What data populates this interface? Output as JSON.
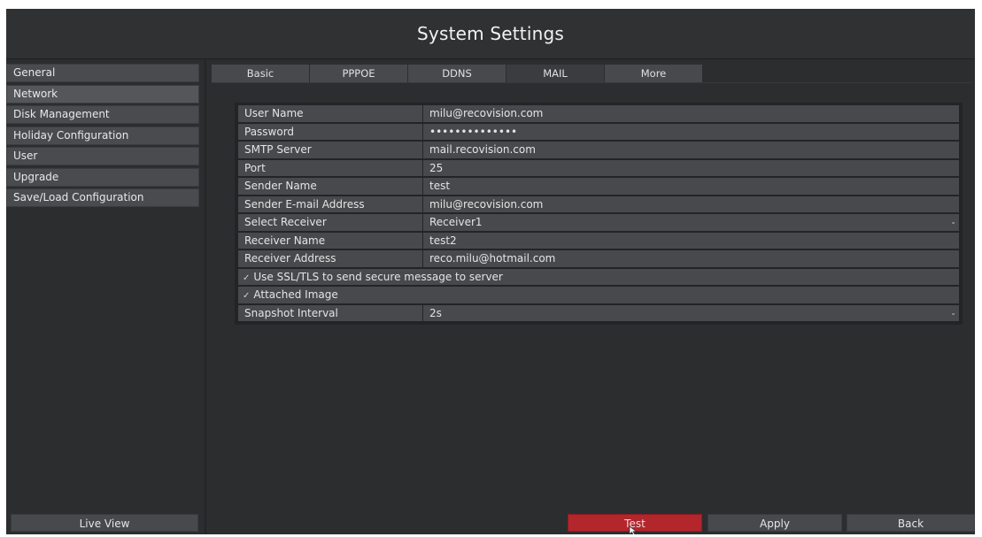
{
  "window": {
    "title": "System Settings"
  },
  "sidebar": {
    "items": [
      {
        "label": "General"
      },
      {
        "label": "Network"
      },
      {
        "label": "Disk Management"
      },
      {
        "label": "Holiday Configuration"
      },
      {
        "label": "User"
      },
      {
        "label": "Upgrade"
      },
      {
        "label": "Save/Load Configuration"
      }
    ],
    "live_view_label": "Live View"
  },
  "tabs": [
    {
      "label": "Basic"
    },
    {
      "label": "PPPOE"
    },
    {
      "label": "DDNS"
    },
    {
      "label": "MAIL",
      "active": true
    },
    {
      "label": "More"
    }
  ],
  "form": {
    "user_name": {
      "label": "User Name",
      "value": "milu@recovision.com"
    },
    "password": {
      "label": "Password",
      "value": "••••••••••••••"
    },
    "smtp_server": {
      "label": "SMTP Server",
      "value": "mail.recovision.com"
    },
    "port": {
      "label": "Port",
      "value": "25"
    },
    "sender_name": {
      "label": "Sender Name",
      "value": "test"
    },
    "sender_email": {
      "label": "Sender E-mail Address",
      "value": "milu@recovision.com"
    },
    "select_receiver": {
      "label": "Select Receiver",
      "value": "Receiver1"
    },
    "receiver_name": {
      "label": "Receiver Name",
      "value": "test2"
    },
    "receiver_address": {
      "label": "Receiver Address",
      "value": "reco.milu@hotmail.com"
    },
    "use_ssl": {
      "label": "Use SSL/TLS to send secure message to server",
      "checked": true
    },
    "attached_image": {
      "label": "Attached Image",
      "checked": true
    },
    "snapshot_interval": {
      "label": "Snapshot Interval",
      "value": "2s"
    }
  },
  "buttons": {
    "test": "Test",
    "apply": "Apply",
    "back": "Back"
  },
  "icons": {
    "checkbox": "check-icon",
    "dropdown": "chevron-down-icon",
    "cursor": "mouse-cursor-icon"
  },
  "colors": {
    "accent_test_button": "#b2262c",
    "background": "#2c2d2f",
    "field": "#48494c"
  }
}
